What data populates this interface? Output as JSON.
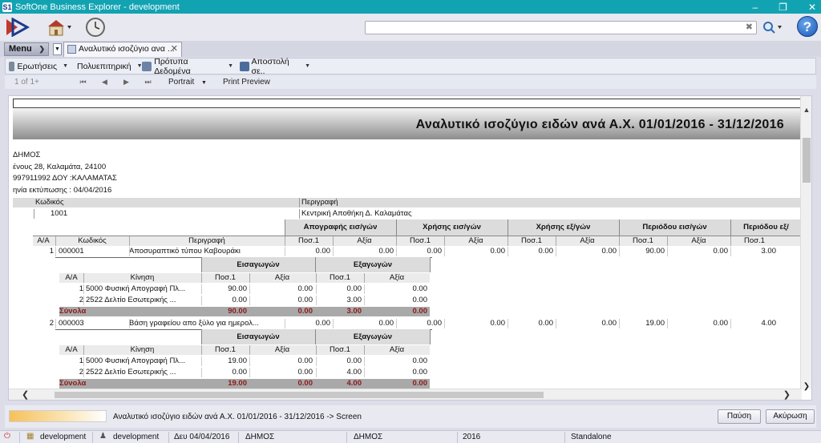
{
  "window": {
    "title": "SoftOne Business Explorer - development",
    "app_icon": "S1",
    "minimize": "–",
    "maximize": "❐",
    "close": "✕"
  },
  "search": {
    "value": "",
    "clear_icon": "✖"
  },
  "menu": {
    "label": "Menu"
  },
  "tab": {
    "label": "Αναλυτικό ισοζύγιο ανα ..."
  },
  "toolbar": [
    {
      "label": "Ερωτήσεις",
      "icon": "questions-icon",
      "color": "#7a8a9c"
    },
    {
      "label": "Πολυεπιτηρική",
      "icon": "grid-icon",
      "color": "#5b7a9a"
    },
    {
      "label": "Πρότυπα Δεδομένα",
      "icon": "template-icon",
      "color": "#6b83a8"
    },
    {
      "label": "Αποστολή σε..",
      "icon": "send-icon",
      "color": "#4c6d9c"
    }
  ],
  "nav": {
    "page": "1 of 1+",
    "first": "⏮",
    "prev": "◀",
    "next": "▶",
    "last": "⏭",
    "portrait": "Portrait",
    "print_preview": "Print Preview"
  },
  "report": {
    "title": "Αναλυτικό ισοζύγιο ειδών ανά Α.Χ. 01/01/2016 - 31/12/2016",
    "info": [
      "ΔΗΜΟΣ",
      "ένους 28, Καλαμάτα, 24100",
      "997911992 ΔΟΥ :ΚΑΛΑΜΑΤΑΣ",
      "ηνία εκτύπωσης : 04/04/2016"
    ],
    "warehouse_hdr": {
      "code": "Κωδικός",
      "desc": "Περιγραφή"
    },
    "warehouse": {
      "code": "1001",
      "desc": "Κεντρική Αποθήκη Δ. Καλαμάτας"
    },
    "groups": [
      "Απογραφής εισ/γών",
      "Χρήσης εισ/γών",
      "Χρήσης εξ/γών",
      "Περιόδου εισ/γών",
      "Περιόδου εξ/"
    ],
    "col_hdr": {
      "aa": "Α/Α",
      "code": "Κωδικός",
      "desc": "Περιγραφή",
      "qty": "Ποσ.1",
      "val": "Αξία"
    },
    "sub_groups": [
      "Εισαγωγών",
      "Εξαγωγών"
    ],
    "sub_hdr": {
      "aa": "Α/Α",
      "move": "Κίνηση",
      "qty": "Ποσ.1",
      "val": "Αξία"
    },
    "totals_label": "Σύνολα",
    "items": [
      {
        "aa": "1",
        "code": "000001",
        "desc": "Αποσυραπτικό τύπου Καβουράκι",
        "nums": [
          "0.00",
          "0.00",
          "0.00",
          "0.00",
          "0.00",
          "0.00",
          "90.00",
          "0.00",
          "3.00"
        ],
        "moves": [
          {
            "aa": "1",
            "move": "5000 Φυσική Απογραφή Πλ...",
            "eq": "90.00",
            "ev": "0.00",
            "xq": "0.00",
            "xv": "0.00"
          },
          {
            "aa": "2",
            "move": "2522 Δελτίο Εσωτερικής ...",
            "eq": "0.00",
            "ev": "0.00",
            "xq": "3.00",
            "xv": "0.00"
          }
        ],
        "totals": {
          "eq": "90.00",
          "ev": "0.00",
          "xq": "3.00",
          "xv": "0.00"
        }
      },
      {
        "aa": "2",
        "code": "000003",
        "desc": "Βάση γραφείου απο ξύλο για ημερολ...",
        "nums": [
          "0.00",
          "0.00",
          "0.00",
          "0.00",
          "0.00",
          "0.00",
          "19.00",
          "0.00",
          "4.00"
        ],
        "moves": [
          {
            "aa": "1",
            "move": "5000 Φυσική Απογραφή Πλ...",
            "eq": "19.00",
            "ev": "0.00",
            "xq": "0.00",
            "xv": "0.00"
          },
          {
            "aa": "2",
            "move": "2522 Δελτίο Εσωτερικής ...",
            "eq": "0.00",
            "ev": "0.00",
            "xq": "4.00",
            "xv": "0.00"
          }
        ],
        "totals": {
          "eq": "19.00",
          "ev": "0.00",
          "xq": "4.00",
          "xv": "0.00"
        }
      }
    ]
  },
  "status": {
    "text": "Αναλυτικό ισοζύγιο ειδών ανά Α.Χ.  01/01/2016 - 31/12/2016 -> Screen",
    "pause": "Παύση",
    "cancel": "Ακύρωση"
  },
  "statusbar": {
    "company": "development",
    "user": "development",
    "date": "Δευ 04/04/2016",
    "branch": "ΔΗΜΟΣ",
    "branch2": "ΔΗΜΟΣ",
    "year": "2016",
    "mode": "Standalone"
  },
  "colors": {
    "titlebar": "#12a3b2",
    "totals": "#8b1a1a"
  }
}
